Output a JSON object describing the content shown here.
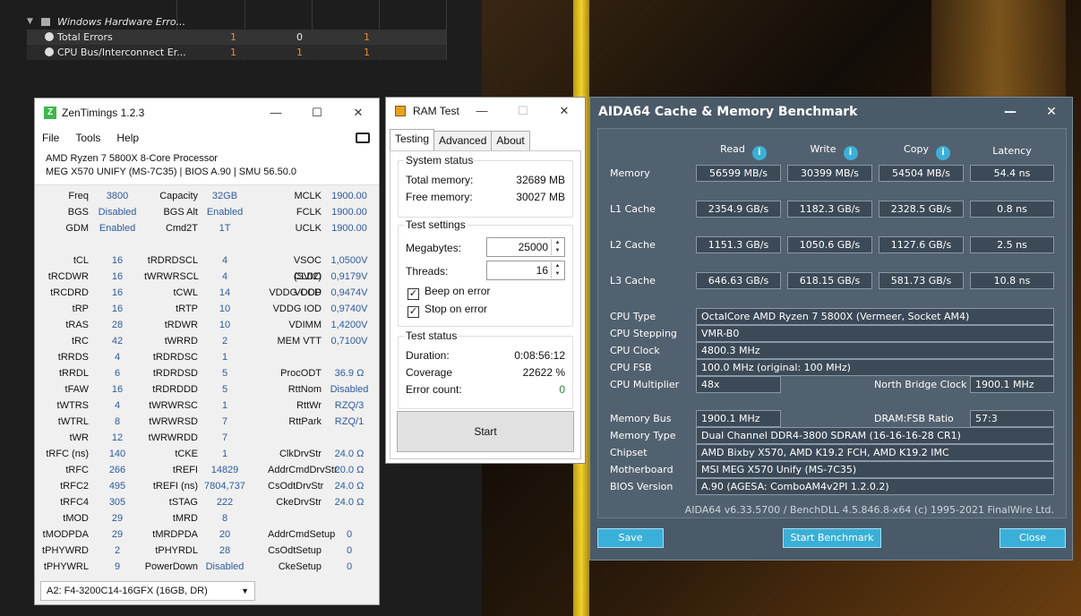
{
  "hwinfo": {
    "group_label": "Windows Hardware Erro...",
    "rows": [
      {
        "label": "Total Errors",
        "values": [
          "1",
          "0",
          "1"
        ]
      },
      {
        "label": "CPU Bus/Interconnect Er...",
        "values": [
          "1",
          "1",
          "1"
        ]
      }
    ],
    "colors": {
      "orange": "#e8902a",
      "text": "#e8e8e8"
    }
  },
  "zentimings": {
    "title": "ZenTimings 1.2.3",
    "menu": [
      "File",
      "Tools",
      "Help"
    ],
    "cpu": "AMD Ryzen 7 5800X 8-Core Processor",
    "board": "MEG X570 UNIFY (MS-7C35) | BIOS A.90 | SMU 56.50.0",
    "col1": [
      {
        "k": "Freq",
        "v": "3800"
      },
      {
        "k": "BGS",
        "v": "Disabled"
      },
      {
        "k": "GDM",
        "v": "Enabled"
      },
      {
        "k": "",
        "v": ""
      },
      {
        "k": "tCL",
        "v": "16"
      },
      {
        "k": "tRCDWR",
        "v": "16"
      },
      {
        "k": "tRCDRD",
        "v": "16"
      },
      {
        "k": "tRP",
        "v": "16"
      },
      {
        "k": "tRAS",
        "v": "28"
      },
      {
        "k": "tRC",
        "v": "42"
      },
      {
        "k": "tRRDS",
        "v": "4"
      },
      {
        "k": "tRRDL",
        "v": "6"
      },
      {
        "k": "tFAW",
        "v": "16"
      },
      {
        "k": "tWTRS",
        "v": "4"
      },
      {
        "k": "tWTRL",
        "v": "8"
      },
      {
        "k": "tWR",
        "v": "12"
      },
      {
        "k": "tRFC (ns)",
        "v": "140"
      },
      {
        "k": "tRFC",
        "v": "266"
      },
      {
        "k": "tRFC2",
        "v": "495"
      },
      {
        "k": "tRFC4",
        "v": "305"
      },
      {
        "k": "tMOD",
        "v": "29"
      },
      {
        "k": "tMODPDA",
        "v": "29"
      },
      {
        "k": "tPHYWRD",
        "v": "2"
      },
      {
        "k": "tPHYWRL",
        "v": "9"
      }
    ],
    "col2": [
      {
        "k": "Capacity",
        "v": "32GB"
      },
      {
        "k": "BGS Alt",
        "v": "Enabled"
      },
      {
        "k": "Cmd2T",
        "v": "1T"
      },
      {
        "k": "",
        "v": ""
      },
      {
        "k": "tRDRDSCL",
        "v": "4"
      },
      {
        "k": "tWRWRSCL",
        "v": "4"
      },
      {
        "k": "tCWL",
        "v": "14"
      },
      {
        "k": "tRTP",
        "v": "10"
      },
      {
        "k": "tRDWR",
        "v": "10"
      },
      {
        "k": "tWRRD",
        "v": "2"
      },
      {
        "k": "tRDRDSC",
        "v": "1"
      },
      {
        "k": "tRDRDSD",
        "v": "5"
      },
      {
        "k": "tRDRDDD",
        "v": "5"
      },
      {
        "k": "tWRWRSC",
        "v": "1"
      },
      {
        "k": "tWRWRSD",
        "v": "7"
      },
      {
        "k": "tWRWRDD",
        "v": "7"
      },
      {
        "k": "tCKE",
        "v": "1"
      },
      {
        "k": "tREFI",
        "v": "14829"
      },
      {
        "k": "tREFI (ns)",
        "v": "7804,737"
      },
      {
        "k": "tSTAG",
        "v": "222"
      },
      {
        "k": "tMRD",
        "v": "8"
      },
      {
        "k": "tMRDPDA",
        "v": "20"
      },
      {
        "k": "tPHYRDL",
        "v": "28"
      },
      {
        "k": "PowerDown",
        "v": "Disabled"
      }
    ],
    "col3": [
      {
        "k": "MCLK",
        "v": "1900.00"
      },
      {
        "k": "FCLK",
        "v": "1900.00"
      },
      {
        "k": "UCLK",
        "v": "1900.00"
      },
      {
        "k": "",
        "v": ""
      },
      {
        "k": "VSOC (SVI2)",
        "v": "1,0500V"
      },
      {
        "k": "CLDO VDDP",
        "v": "0,9179V"
      },
      {
        "k": "VDDG CCD",
        "v": "0,9474V"
      },
      {
        "k": "VDDG IOD",
        "v": "0,9740V"
      },
      {
        "k": "VDIMM",
        "v": "1,4200V"
      },
      {
        "k": "MEM VTT",
        "v": "0,7100V"
      },
      {
        "k": "",
        "v": ""
      },
      {
        "k": "ProcODT",
        "v": "36.9 Ω"
      },
      {
        "k": "RttNom",
        "v": "Disabled"
      },
      {
        "k": "RttWr",
        "v": "RZQ/3"
      },
      {
        "k": "RttPark",
        "v": "RZQ/1"
      },
      {
        "k": "",
        "v": ""
      },
      {
        "k": "ClkDrvStr",
        "v": "24.0 Ω"
      },
      {
        "k": "AddrCmdDrvStr",
        "v": "20.0 Ω"
      },
      {
        "k": "CsOdtDrvStr",
        "v": "24.0 Ω"
      },
      {
        "k": "CkeDrvStr",
        "v": "24.0 Ω"
      },
      {
        "k": "",
        "v": ""
      },
      {
        "k": "AddrCmdSetup",
        "v": "0"
      },
      {
        "k": "CsOdtSetup",
        "v": "0"
      },
      {
        "k": "CkeSetup",
        "v": "0"
      }
    ],
    "module": "A2: F4-3200C14-16GFX (16GB, DR)"
  },
  "ramtest": {
    "title": "RAM Test",
    "tabs": [
      "Testing",
      "Advanced",
      "About"
    ],
    "system_status": "System status",
    "total_memory_label": "Total memory:",
    "total_memory": "32689 MB",
    "free_memory_label": "Free memory:",
    "free_memory": "30027 MB",
    "test_settings": "Test settings",
    "megabytes_label": "Megabytes:",
    "megabytes": "25000",
    "threads_label": "Threads:",
    "threads": "16",
    "beep_label": "Beep on error",
    "stop_label": "Stop on error",
    "test_status": "Test status",
    "duration_label": "Duration:",
    "duration": "0:08:56:12",
    "coverage_label": "Coverage",
    "coverage": "22622 %",
    "errors_label": "Error count:",
    "errors": "0",
    "start": "Start"
  },
  "aida": {
    "title": "AIDA64 Cache & Memory Benchmark",
    "headers": [
      "Read",
      "Write",
      "Copy",
      "Latency"
    ],
    "rows": [
      {
        "label": "Memory",
        "v": [
          "56599 MB/s",
          "30399 MB/s",
          "54504 MB/s",
          "54.4 ns"
        ]
      },
      {
        "label": "L1 Cache",
        "v": [
          "2354.9 GB/s",
          "1182.3 GB/s",
          "2328.5 GB/s",
          "0.8 ns"
        ]
      },
      {
        "label": "L2 Cache",
        "v": [
          "1151.3 GB/s",
          "1050.6 GB/s",
          "1127.6 GB/s",
          "2.5 ns"
        ]
      },
      {
        "label": "L3 Cache",
        "v": [
          "646.63 GB/s",
          "618.15 GB/s",
          "581.73 GB/s",
          "10.8 ns"
        ]
      }
    ],
    "cpu_type_label": "CPU Type",
    "cpu_type": "OctalCore AMD Ryzen 7 5800X  (Vermeer, Socket AM4)",
    "cpu_stepping_label": "CPU Stepping",
    "cpu_stepping": "VMR-B0",
    "cpu_clock_label": "CPU Clock",
    "cpu_clock": "4800.3 MHz",
    "cpu_fsb_label": "CPU FSB",
    "cpu_fsb": "100.0 MHz  (original: 100 MHz)",
    "cpu_mult_label": "CPU Multiplier",
    "cpu_mult": "48x",
    "nb_clock_label": "North Bridge Clock",
    "nb_clock": "1900.1 MHz",
    "mem_bus_label": "Memory Bus",
    "mem_bus": "1900.1 MHz",
    "dram_fsb_label": "DRAM:FSB Ratio",
    "dram_fsb": "57:3",
    "mem_type_label": "Memory Type",
    "mem_type": "Dual Channel DDR4-3800 SDRAM  (16-16-16-28 CR1)",
    "chipset_label": "Chipset",
    "chipset": "AMD Bixby X570, AMD K19.2 FCH, AMD K19.2 IMC",
    "mobo_label": "Motherboard",
    "mobo": "MSI MEG X570 Unify (MS-7C35)",
    "bios_label": "BIOS Version",
    "bios": "A.90  (AGESA: ComboAM4v2PI 1.2.0.2)",
    "footer": "AIDA64 v6.33.5700 / BenchDLL 4.5.846.8-x64  (c) 1995-2021 FinalWire Ltd.",
    "save": "Save",
    "start": "Start Benchmark",
    "close": "Close"
  }
}
